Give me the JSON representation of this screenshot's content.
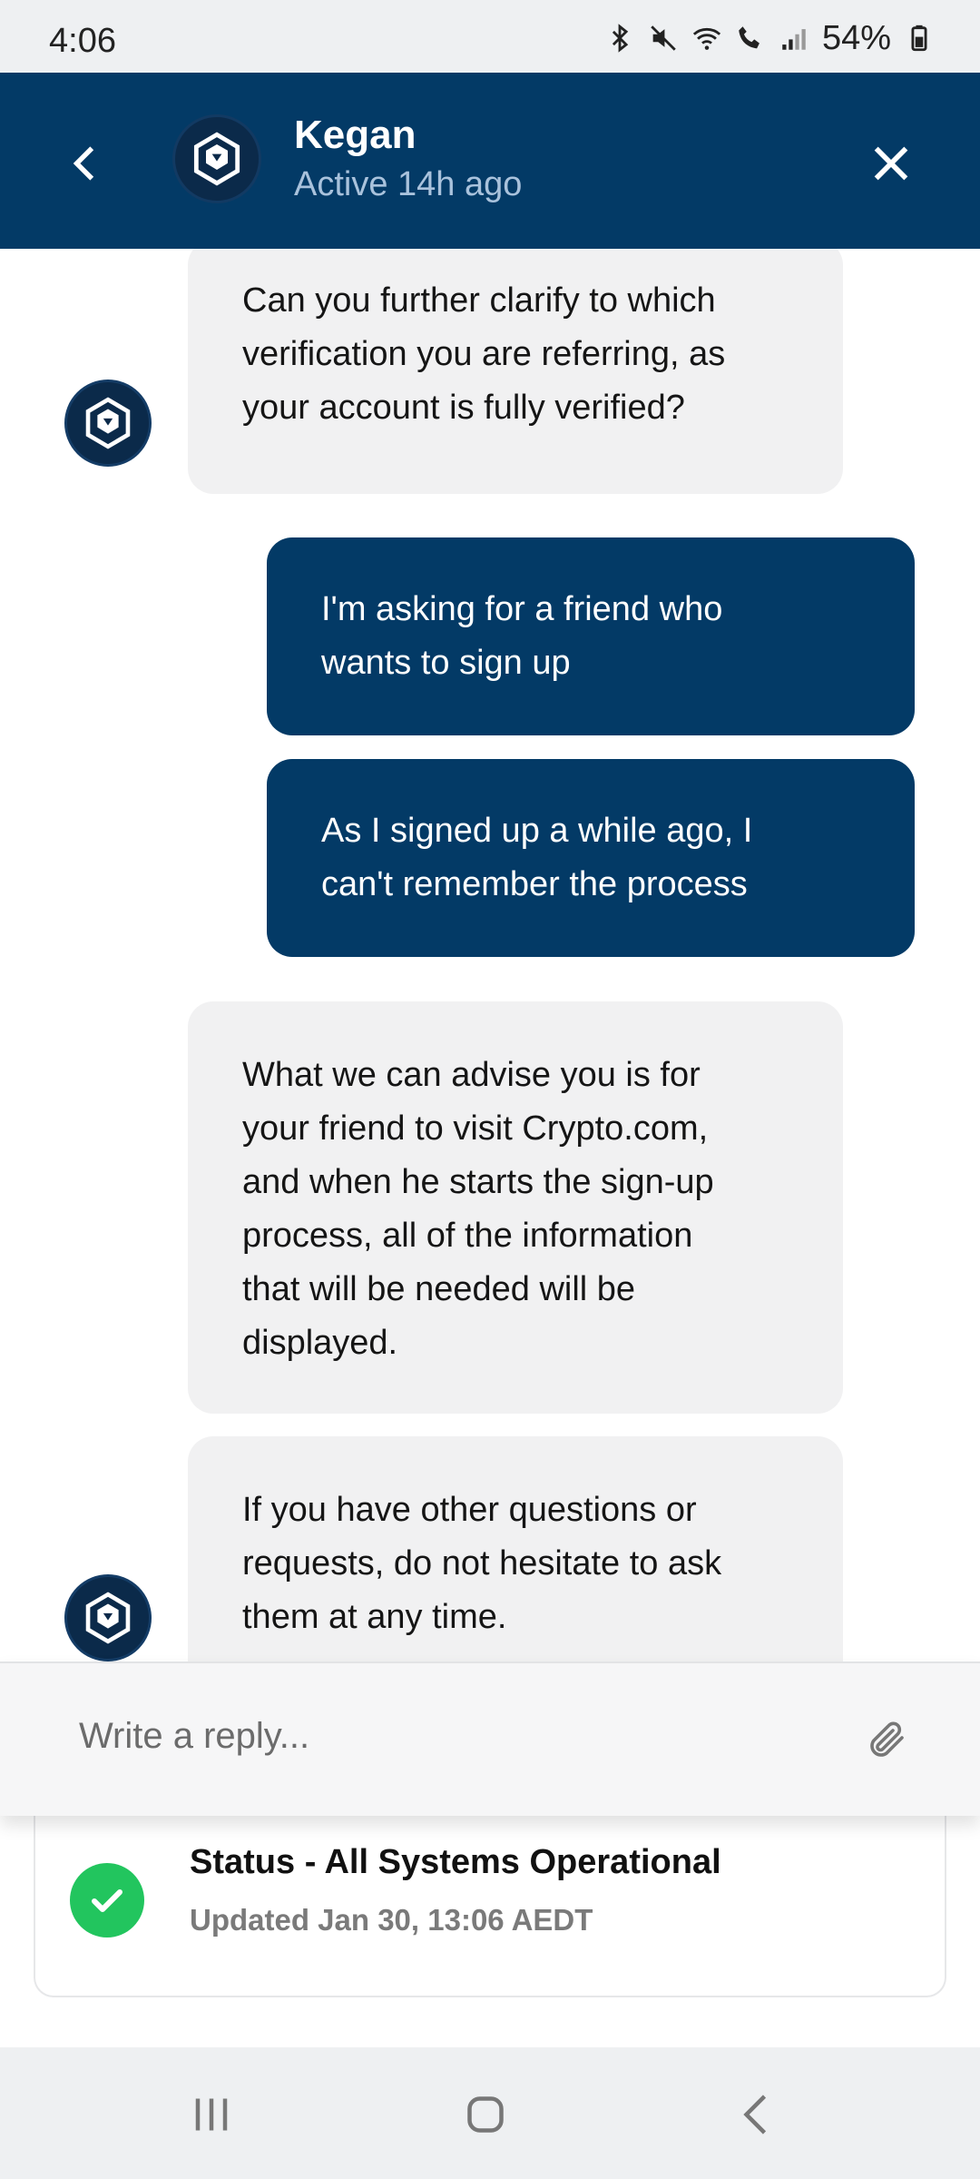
{
  "status_bar": {
    "time": "4:06",
    "battery": "54%",
    "icons": [
      "bluetooth-icon",
      "mute-icon",
      "wifi-icon",
      "wifi-calling-icon",
      "signal-icon",
      "battery-icon"
    ]
  },
  "header": {
    "back_icon": "chevron-left-icon",
    "avatar_icon": "crypto-com-logo",
    "name": "Kegan",
    "activity": "Active 14h ago",
    "close_icon": "close-icon"
  },
  "messages": [
    {
      "from": "agent",
      "lines": [
        "Can you further clarify to which",
        "verification you are referring, as",
        "your account is fully verified?"
      ]
    },
    {
      "from": "user",
      "lines": [
        "I'm asking for a friend who",
        "wants to sign up"
      ]
    },
    {
      "from": "user",
      "lines": [
        "As I signed up a while ago, I",
        "can't remember the process"
      ]
    },
    {
      "from": "agent",
      "lines": [
        "What we can advise you is for",
        "your friend to visit Crypto.com,",
        "and when he starts the sign-up",
        "process, all of the information",
        "that will be needed will be",
        "displayed."
      ]
    },
    {
      "from": "agent",
      "lines": [
        "If you have other questions or",
        "requests, do not hesitate to ask",
        "them at any time."
      ]
    }
  ],
  "reply": {
    "placeholder": "Write a reply...",
    "attach_icon": "paperclip-icon"
  },
  "status": {
    "title": "Status - All Systems Operational",
    "updated": "Updated Jan 30, 13:06 AEDT",
    "color": "#22c55e"
  },
  "colors": {
    "brand": "#033a66",
    "bubble_in": "#f1f1f2",
    "bubble_out": "#033a66"
  },
  "nav": {
    "icons": [
      "recent-apps-icon",
      "home-icon",
      "back-icon"
    ]
  }
}
